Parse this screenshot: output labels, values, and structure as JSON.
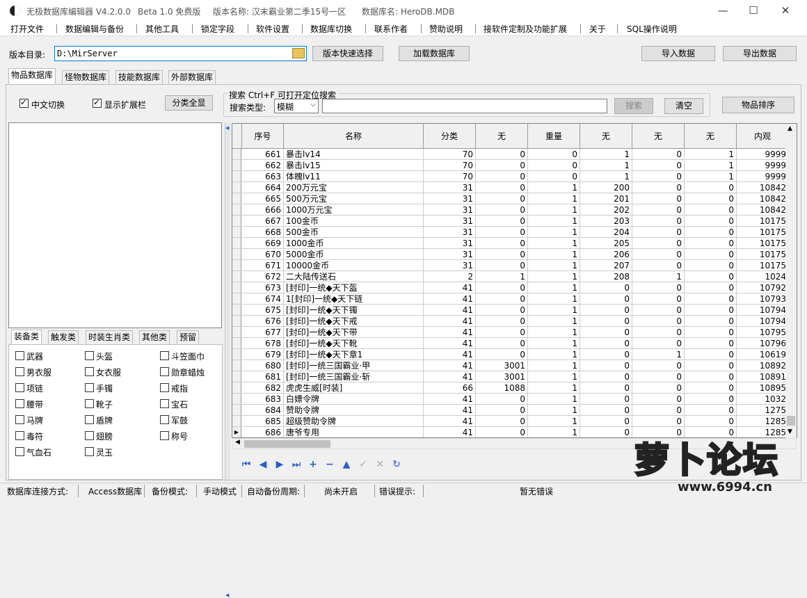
{
  "titlebar": {
    "app_name": "无极数据库编辑器 V4.2.0.0",
    "edition": "Beta 1.0 免费版",
    "version_name": "版本名称: 汉末霸业第二季15号一区",
    "db_name": "数据库名: HeroDB.MDB",
    "min": "—",
    "max": "☐",
    "close": "✕"
  },
  "menu": [
    "打开文件",
    "数据编辑与备份",
    "其他工具",
    "锁定字段",
    "软件设置",
    "数据库切换",
    "联系作者",
    "赞助说明",
    "接软件定制及功能扩展",
    "关于",
    "SQL操作说明"
  ],
  "toolbar": {
    "dir_label": "版本目录:",
    "dir_value": "D:\\MirServer",
    "quick_select": "版本快速选择",
    "load_db": "加载数据库",
    "import": "导入数据",
    "export": "导出数据"
  },
  "db_tabs": [
    "物品数据库",
    "怪物数据库",
    "技能数据库",
    "外部数据库"
  ],
  "options": {
    "cn_switch": "中文切换",
    "show_ext": "显示扩展栏",
    "show_all": "分类全显",
    "search_group": "搜索  Ctrl+F 可打开定位搜索",
    "search_type_label": "搜索类型:",
    "search_type_value": "模糊",
    "search_btn": "搜索",
    "clear_btn": "清空",
    "sort_btn": "物品排序"
  },
  "category_tabs": [
    "装备类",
    "触发类",
    "时装生肖类",
    "其他类",
    "预留"
  ],
  "categories": [
    [
      "武器",
      "头盔",
      "斗笠面巾"
    ],
    [
      "男衣服",
      "女衣服",
      "勋章蜡烛"
    ],
    [
      "项链",
      "手镯",
      "戒指"
    ],
    [
      "腰带",
      "靴子",
      "宝石"
    ],
    [
      "马牌",
      "盾牌",
      "军鼓"
    ],
    [
      "毒符",
      "翅膀",
      "称号"
    ],
    [
      "气血石",
      "灵玉",
      ""
    ]
  ],
  "grid": {
    "headers": [
      "序号",
      "名称",
      "分类",
      "无",
      "重量",
      "无",
      "无",
      "无",
      "内观"
    ],
    "rows": [
      [
        "661",
        "暴击lv14",
        "70",
        "0",
        "0",
        "1",
        "0",
        "1",
        "9999"
      ],
      [
        "662",
        "暴击lv15",
        "70",
        "0",
        "0",
        "1",
        "0",
        "1",
        "9999"
      ],
      [
        "663",
        "体魄lv11",
        "70",
        "0",
        "0",
        "1",
        "0",
        "1",
        "9999"
      ],
      [
        "664",
        "200万元宝",
        "31",
        "0",
        "1",
        "200",
        "0",
        "0",
        "10842"
      ],
      [
        "665",
        "500万元宝",
        "31",
        "0",
        "1",
        "201",
        "0",
        "0",
        "10842"
      ],
      [
        "666",
        "1000万元宝",
        "31",
        "0",
        "1",
        "202",
        "0",
        "0",
        "10842"
      ],
      [
        "667",
        "100金币",
        "31",
        "0",
        "1",
        "203",
        "0",
        "0",
        "10175"
      ],
      [
        "668",
        "500金币",
        "31",
        "0",
        "1",
        "204",
        "0",
        "0",
        "10175"
      ],
      [
        "669",
        "1000金币",
        "31",
        "0",
        "1",
        "205",
        "0",
        "0",
        "10175"
      ],
      [
        "670",
        "5000金币",
        "31",
        "0",
        "1",
        "206",
        "0",
        "0",
        "10175"
      ],
      [
        "671",
        "10000金币",
        "31",
        "0",
        "1",
        "207",
        "0",
        "0",
        "10175"
      ],
      [
        "672",
        "二大陆传送石",
        "2",
        "1",
        "1",
        "208",
        "1",
        "0",
        "1024"
      ],
      [
        "673",
        "[封印]一统◆天下盔",
        "41",
        "0",
        "1",
        "0",
        "0",
        "0",
        "10792"
      ],
      [
        "674",
        "1[封印]一统◆天下链",
        "41",
        "0",
        "1",
        "0",
        "0",
        "0",
        "10793"
      ],
      [
        "675",
        "[封印]一统◆天下镯",
        "41",
        "0",
        "1",
        "0",
        "0",
        "0",
        "10794"
      ],
      [
        "676",
        "[封印]一统◆天下戒",
        "41",
        "0",
        "1",
        "0",
        "0",
        "0",
        "10794"
      ],
      [
        "677",
        "[封印]一统◆天下带",
        "41",
        "0",
        "1",
        "0",
        "0",
        "0",
        "10795"
      ],
      [
        "678",
        "[封印]一统◆天下靴",
        "41",
        "0",
        "1",
        "0",
        "0",
        "0",
        "10796"
      ],
      [
        "679",
        "[封印]一统◆天下章1",
        "41",
        "0",
        "1",
        "0",
        "1",
        "0",
        "10619"
      ],
      [
        "680",
        "[封印]一统三国霸业·甲",
        "41",
        "3001",
        "1",
        "0",
        "0",
        "0",
        "10892"
      ],
      [
        "681",
        "[封印]一统三国霸业·斩",
        "41",
        "3001",
        "1",
        "0",
        "0",
        "0",
        "10891"
      ],
      [
        "682",
        "虎虎生威[时装]",
        "66",
        "1088",
        "1",
        "0",
        "0",
        "0",
        "10895"
      ],
      [
        "683",
        "白嫖令牌",
        "41",
        "0",
        "1",
        "0",
        "0",
        "0",
        "1032"
      ],
      [
        "684",
        "赞助令牌",
        "41",
        "0",
        "1",
        "0",
        "0",
        "0",
        "1275"
      ],
      [
        "685",
        "超级赞助令牌",
        "41",
        "0",
        "1",
        "0",
        "0",
        "0",
        "1285"
      ],
      [
        "686",
        "唐爷专用",
        "41",
        "0",
        "1",
        "0",
        "0",
        "0",
        "1285"
      ]
    ]
  },
  "status": {
    "conn_label": "数据库连接方式:",
    "conn_value": "Access数据库",
    "backup_label": "备份模式:",
    "backup_value": "手动模式",
    "auto_label": "自动备份周期:",
    "auto_value": "尚未开启",
    "err_label": "错误提示:",
    "err_value": "暂无错误"
  },
  "watermark": {
    "brand": "萝卜论坛",
    "url": "www.6994.cn"
  }
}
